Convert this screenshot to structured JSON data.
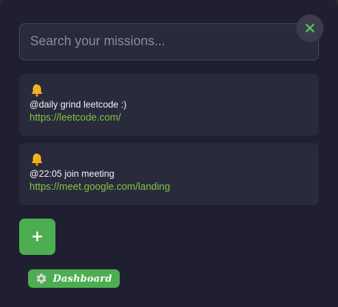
{
  "search": {
    "placeholder": "Search your missions...",
    "value": ""
  },
  "close_icon": "close-icon",
  "missions": [
    {
      "icon": "bell-icon",
      "text": "@daily grind leetcode :)",
      "link": "https://leetcode.com/"
    },
    {
      "icon": "bell-icon",
      "text": "@22:05 join meeting",
      "link": "https://meet.google.com/landing"
    }
  ],
  "add_button": {
    "label": "+"
  },
  "dashboard_button": {
    "icon": "gear-icon",
    "label": "Dashboard"
  },
  "colors": {
    "background": "#1f1f31",
    "card": "#2a2a3d",
    "accent_green": "#4cae50",
    "link_green": "#7cc63f",
    "bell": "#f5b021"
  }
}
